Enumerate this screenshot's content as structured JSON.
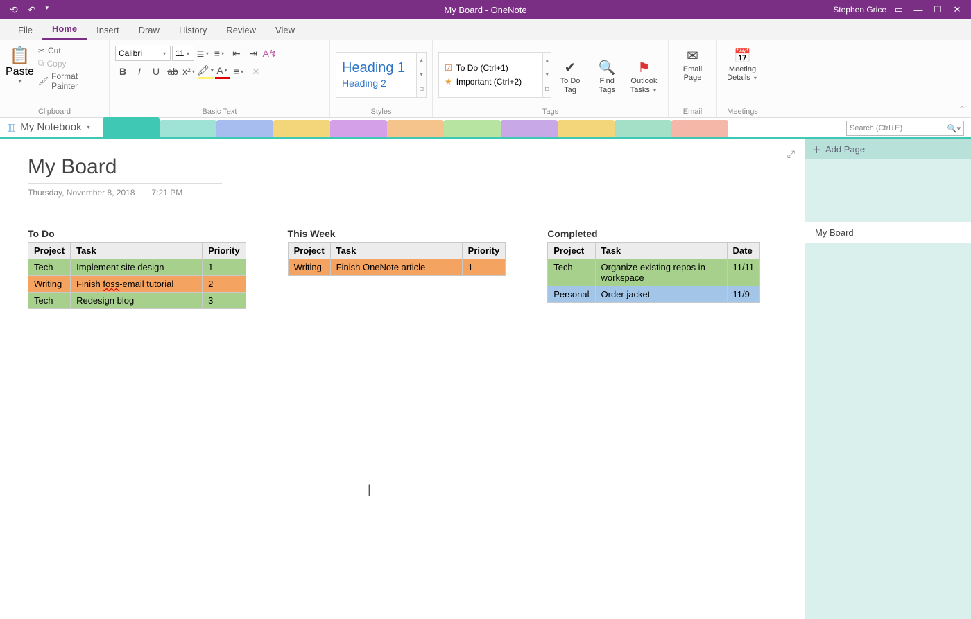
{
  "titlebar": {
    "title": "My Board  -  OneNote",
    "user": "Stephen Grice"
  },
  "ribbon_tabs": [
    "File",
    "Home",
    "Insert",
    "Draw",
    "History",
    "Review",
    "View"
  ],
  "active_tab": "Home",
  "ribbon": {
    "clipboard": {
      "paste": "Paste",
      "cut": "Cut",
      "copy": "Copy",
      "fmtpainter": "Format Painter",
      "group": "Clipboard"
    },
    "basic_text": {
      "font": "Calibri",
      "size": "11",
      "group": "Basic Text"
    },
    "styles": {
      "h1": "Heading 1",
      "h2": "Heading 2",
      "group": "Styles"
    },
    "tags": {
      "todo": "To Do (Ctrl+1)",
      "important": "Important (Ctrl+2)",
      "todo_btn": "To Do\nTag",
      "find": "Find\nTags",
      "outlook": "Outlook\nTasks",
      "group": "Tags"
    },
    "email": {
      "btn": "Email\nPage",
      "group": "Email"
    },
    "meetings": {
      "btn": "Meeting\nDetails",
      "group": "Meetings"
    }
  },
  "notebook": {
    "name": "My Notebook",
    "search_placeholder": "Search (Ctrl+E)"
  },
  "page": {
    "title": "My Board",
    "date": "Thursday, November 8, 2018",
    "time": "7:21 PM"
  },
  "boards": {
    "todo": {
      "title": "To Do",
      "cols": [
        "Project",
        "Task",
        "Priority"
      ],
      "rows": [
        {
          "project": "Tech",
          "task": "Implement site design",
          "priority": "1",
          "rowclass": "row-green"
        },
        {
          "project": "Writing",
          "task_pre": "Finish ",
          "task_mid": "foss",
          "task_post": "-email tutorial",
          "priority": "2",
          "rowclass": "row-orange"
        },
        {
          "project": "Tech",
          "task": "Redesign blog",
          "priority": "3",
          "rowclass": "row-green"
        }
      ]
    },
    "week": {
      "title": "This Week",
      "cols": [
        "Project",
        "Task",
        "Priority"
      ],
      "rows": [
        {
          "project": "Writing",
          "task": "Finish OneNote article",
          "priority": "1",
          "rowclass": "row-orange"
        }
      ]
    },
    "done": {
      "title": "Completed",
      "cols": [
        "Project",
        "Task",
        "Date"
      ],
      "rows": [
        {
          "project": "Tech",
          "task": "Organize existing repos in workspace",
          "date": "11/11",
          "rowclass": "row-green"
        },
        {
          "project": "Personal",
          "task": "Order jacket",
          "date": "11/9",
          "rowclass": "row-blue"
        }
      ]
    }
  },
  "pagelist": {
    "addpage": "Add Page",
    "active_page": "My Board"
  },
  "section_colors": [
    "#3fc9b4",
    "#9ee3d5",
    "#a8bdef",
    "#f4d67a",
    "#d4a0e8",
    "#f5c48c",
    "#b7e4a0",
    "#c9a8e8",
    "#f4d67a",
    "#a4e0c8",
    "#f5b8a8"
  ]
}
